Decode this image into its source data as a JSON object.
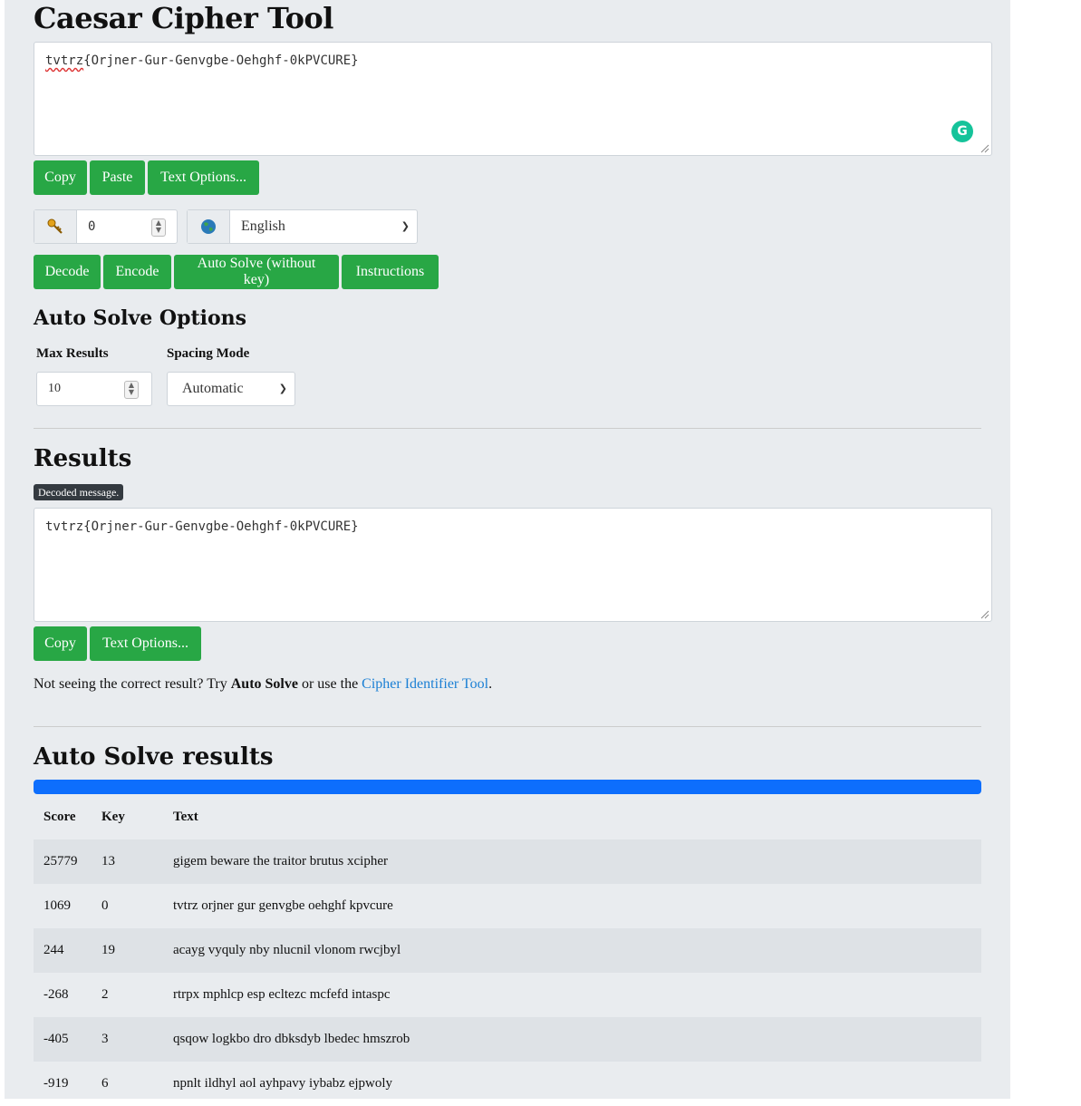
{
  "title": "Caesar Cipher Tool",
  "input": {
    "misspelled": "tvtrz",
    "rest": "{Orjner-Gur-Genvgbe-Oehghf-0kPVCURE}"
  },
  "input_buttons": {
    "copy": "Copy",
    "paste": "Paste",
    "text_options": "Text Options..."
  },
  "key": {
    "icon": "key-icon",
    "value": "0"
  },
  "language": {
    "icon": "globe-icon",
    "selected": "English"
  },
  "actions": {
    "decode": "Decode",
    "encode": "Encode",
    "auto_solve": "Auto Solve (without key)",
    "instructions": "Instructions"
  },
  "auto_solve_options": {
    "heading": "Auto Solve Options",
    "max_results_label": "Max Results",
    "max_results_value": "10",
    "spacing_mode_label": "Spacing Mode",
    "spacing_mode_value": "Automatic"
  },
  "results": {
    "heading": "Results",
    "badge": "Decoded message.",
    "output": "tvtrz{Orjner-Gur-Genvgbe-Oehghf-0kPVCURE}",
    "copy": "Copy",
    "text_options": "Text Options..."
  },
  "note": {
    "prefix": "Not seeing the correct result? Try ",
    "bold": "Auto Solve",
    "middle": " or use the ",
    "link": "Cipher Identifier Tool",
    "suffix": "."
  },
  "auto_solve_results": {
    "heading": "Auto Solve results",
    "progress_percent": 100,
    "columns": [
      "Score",
      "Key",
      "Text"
    ],
    "rows": [
      {
        "score": "25779",
        "key": "13",
        "text": "gigem beware the traitor brutus xcipher"
      },
      {
        "score": "1069",
        "key": "0",
        "text": "tvtrz orjner gur genvgbe oehghf kpvcure"
      },
      {
        "score": "244",
        "key": "19",
        "text": "acayg vyquly nby nlucnil vlonom rwcjbyl"
      },
      {
        "score": "-268",
        "key": "2",
        "text": "rtrpx mphlcp esp ecltezc mcfefd intaspc"
      },
      {
        "score": "-405",
        "key": "3",
        "text": "qsqow logkbo dro dbksdyb lbedec hmszrob"
      },
      {
        "score": "-919",
        "key": "6",
        "text": "npnlt ildhyl aol ayhpavy iybabz ejpwoly"
      }
    ]
  },
  "colors": {
    "button": "#28a745",
    "progress": "#0d6efd",
    "link": "#1a7fd4",
    "panel": "#e9ecef"
  }
}
